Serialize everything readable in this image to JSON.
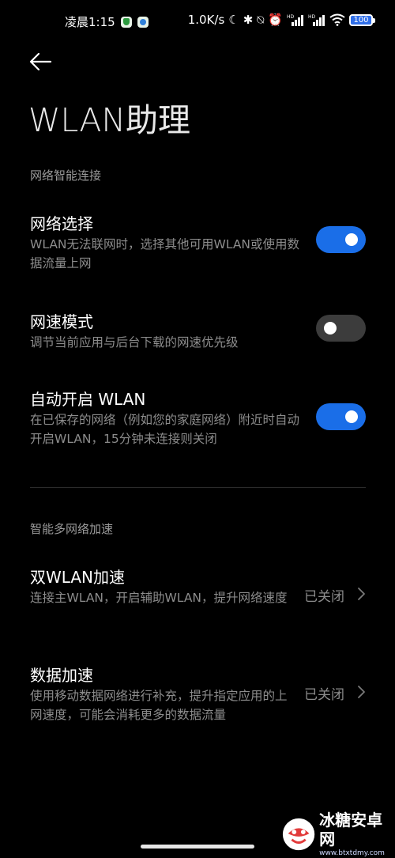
{
  "status_bar": {
    "time": "凌晨1:15",
    "speed": "1.0K/s",
    "battery": "100"
  },
  "page": {
    "title": "WLAN助理"
  },
  "section1": {
    "title": "网络智能连接",
    "items": [
      {
        "title": "网络选择",
        "desc": "WLAN无法联网时，选择其他可用WLAN或使用数据流量上网",
        "toggle": "on"
      },
      {
        "title": "网速模式",
        "desc": "调节当前应用与后台下载的网速优先级",
        "toggle": "off"
      },
      {
        "title": "自动开启 WLAN",
        "desc": "在已保存的网络（例如您的家庭网络）附近时自动开启WLAN，15分钟未连接则关闭",
        "toggle": "on"
      }
    ]
  },
  "section2": {
    "title": "智能多网络加速",
    "items": [
      {
        "title": "双WLAN加速",
        "desc": "连接主WLAN，开启辅助WLAN，提升网络速度",
        "value": "已关闭"
      },
      {
        "title": "数据加速",
        "desc": "使用移动数据网络进行补充，提升指定应用的上网速度，可能会消耗更多的数据流量",
        "value": "已关闭"
      }
    ]
  },
  "watermark": {
    "main": "冰糖安卓网",
    "sub": "www.btxtdmy.com"
  },
  "colors": {
    "accent": "#1a6ee8",
    "toggle_off": "#3c3c3c",
    "background": "#000000"
  }
}
